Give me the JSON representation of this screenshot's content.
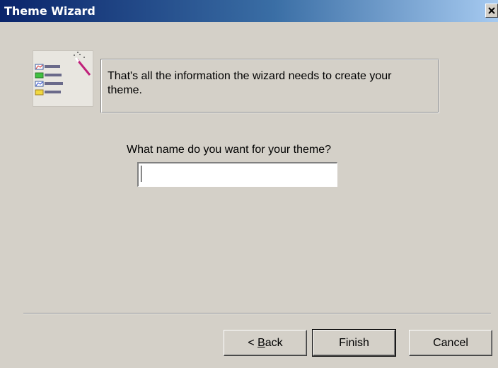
{
  "window": {
    "title": "Theme Wizard"
  },
  "info": {
    "text": "That's all the information the wizard needs to create your theme."
  },
  "prompt": {
    "label": "What name do you want for your theme?"
  },
  "name_input": {
    "value": ""
  },
  "buttons": {
    "back_prefix": "< ",
    "back_accel": "B",
    "back_rest": "ack",
    "finish": "Finish",
    "cancel": "Cancel"
  },
  "icons": {
    "wizard": "wizard-wand-chart-icon",
    "close": "close-icon"
  },
  "colors": {
    "titlebar_start": "#0a246a",
    "titlebar_end": "#a6caf0",
    "face": "#d4d0c8"
  }
}
